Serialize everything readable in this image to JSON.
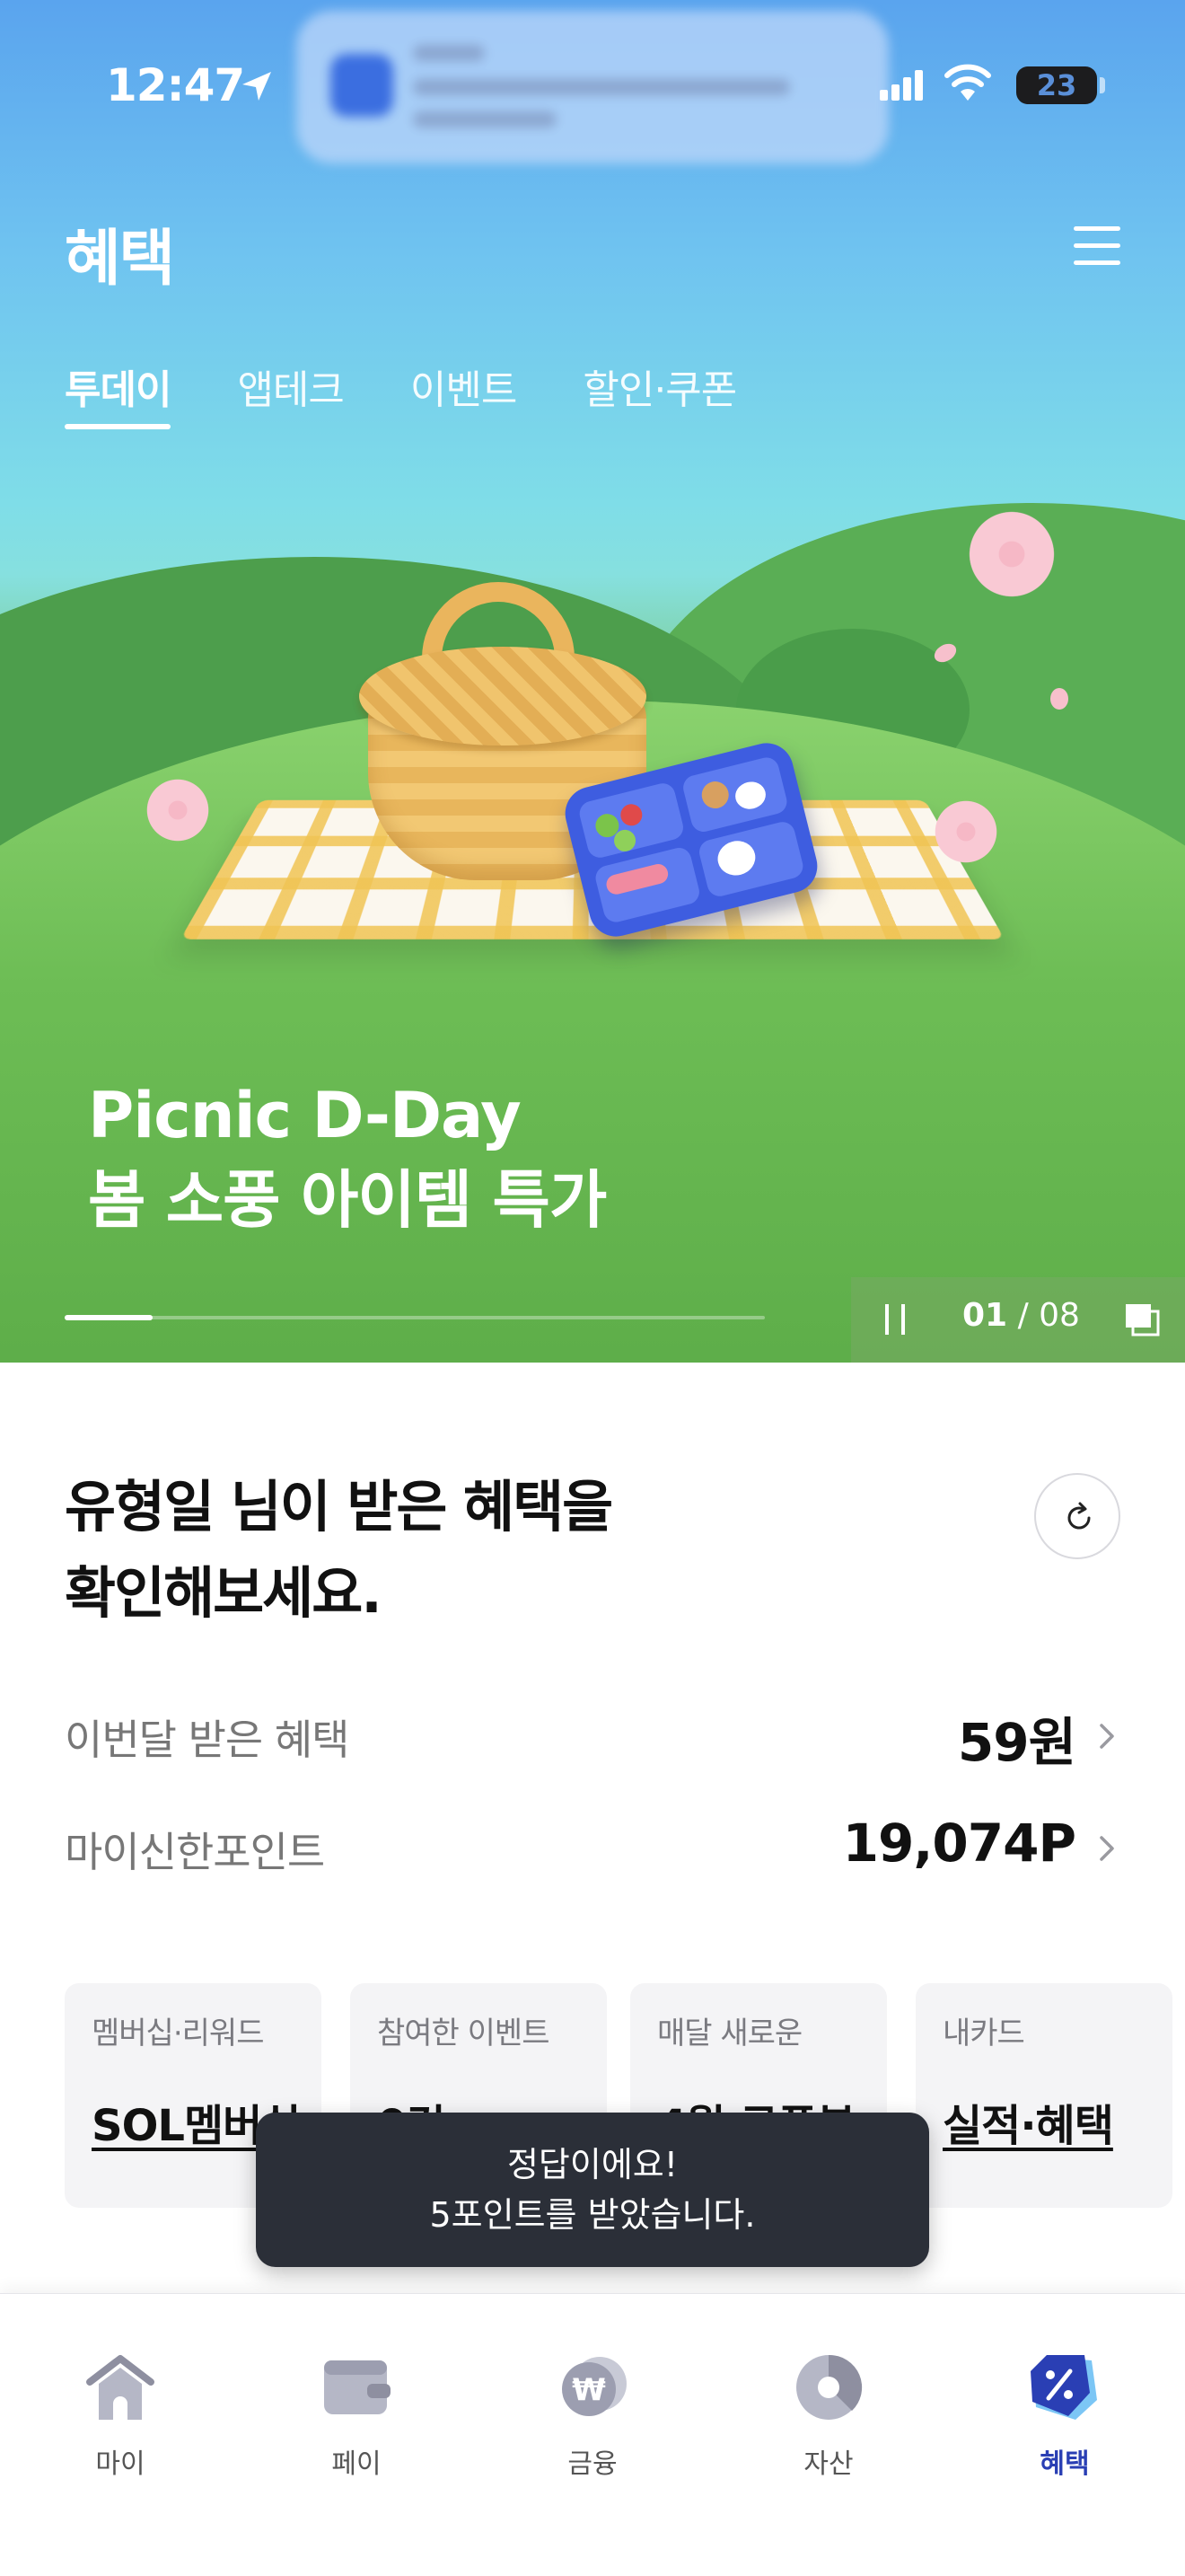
{
  "status_bar": {
    "time": "12:47",
    "battery": "23"
  },
  "header": {
    "title": "혜택"
  },
  "tabs": [
    {
      "label": "투데이",
      "active": true
    },
    {
      "label": "앱테크",
      "active": false
    },
    {
      "label": "이벤트",
      "active": false
    },
    {
      "label": "할인·쿠폰",
      "active": false
    }
  ],
  "banner": {
    "title_line1": "Picnic D-Day",
    "title_line2": "봄 소풍 아이템 특가",
    "current": "01",
    "separator": "/",
    "total": "08",
    "progress_fraction": 0.125
  },
  "summary": {
    "title_line1": "유형일 님이 받은 혜택을",
    "title_line2": "확인해보세요.",
    "rows": [
      {
        "label": "이번달 받은 혜택",
        "value": "59원"
      },
      {
        "label": "마이신한포인트",
        "value": "19,074P"
      }
    ]
  },
  "cards": [
    {
      "title": "멤버십·리워드",
      "value": "SOL멤버십"
    },
    {
      "title": "참여한 이벤트",
      "value": "0건"
    },
    {
      "title": "매달 새로운",
      "value": "4월 쿠폰북"
    },
    {
      "title": "내카드",
      "value": "실적·혜택"
    }
  ],
  "toast": {
    "line1": "정답이에요!",
    "line2": "5포인트를 받았습니다."
  },
  "bottom_nav": [
    {
      "label": "마이",
      "icon": "home-icon",
      "active": false
    },
    {
      "label": "페이",
      "icon": "wallet-icon",
      "active": false
    },
    {
      "label": "금융",
      "icon": "won-coin-icon",
      "active": false
    },
    {
      "label": "자산",
      "icon": "pie-chart-icon",
      "active": false
    },
    {
      "label": "혜택",
      "icon": "discount-tag-icon",
      "active": true
    }
  ],
  "colors": {
    "accent": "#2a3fb4",
    "toast_bg": "#2b2f38",
    "card_bg": "#f4f4f6"
  }
}
